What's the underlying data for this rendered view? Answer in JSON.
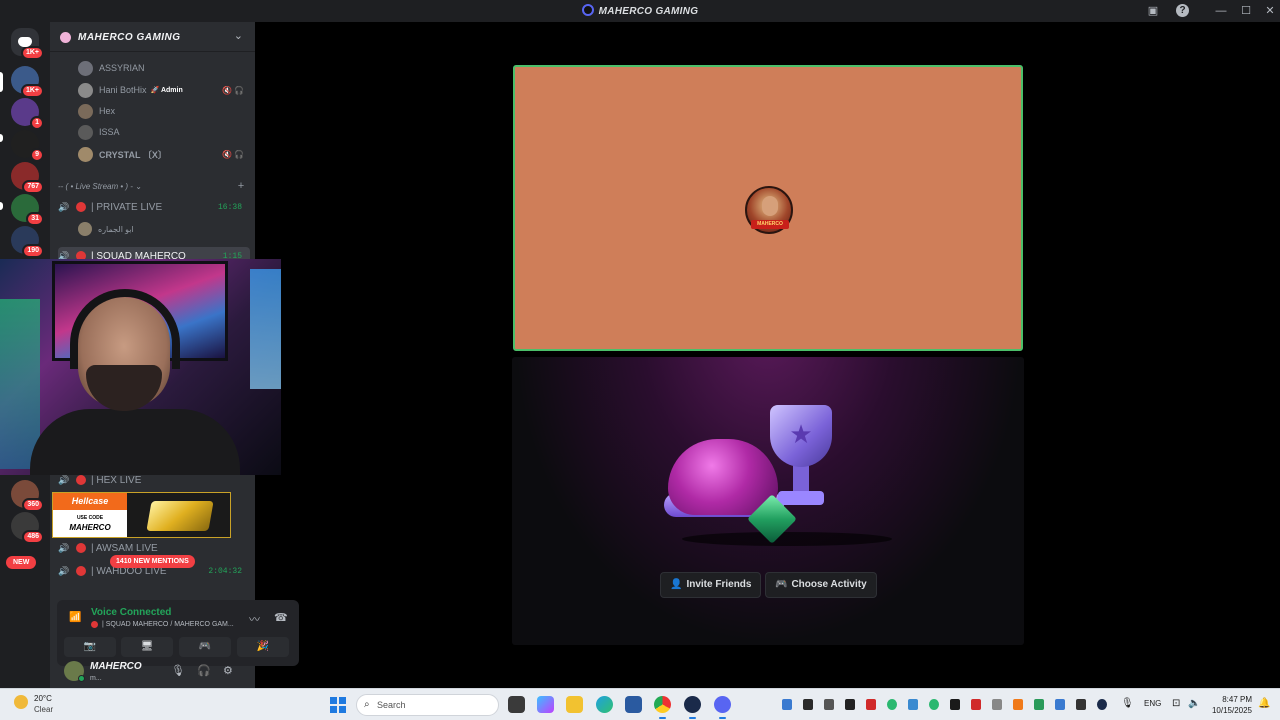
{
  "window": {
    "title": "MAHERCO GAMING",
    "controls": {
      "minimize": "—",
      "maximize": "☐",
      "close": "✕",
      "help": "?"
    }
  },
  "rail": {
    "badges": [
      "1K+",
      "1K+",
      "1",
      "9",
      "767",
      "31",
      "190",
      "360",
      "486"
    ],
    "new_label": "NEW"
  },
  "guild": {
    "name": "MAHERCO GAMING",
    "chevron": "⌄"
  },
  "members": [
    {
      "name": "ASSYRIAN"
    },
    {
      "name": "Hani BotHix",
      "role": "Admin"
    },
    {
      "name": "Hex"
    },
    {
      "name": "ISSA"
    },
    {
      "name": "CRYSTAL 〔X〕"
    }
  ],
  "category": {
    "label": "-- ( • Live Stream • ) -",
    "chevron": "⌄",
    "add": "+"
  },
  "voice_channels": [
    {
      "name": "| PRIVATE LIVE",
      "time": "16:38"
    },
    {
      "name": "| SQUAD MAHERCO",
      "time": "1:15"
    },
    {
      "name": "| HEX LIVE",
      "time": ""
    },
    {
      "name": "| AWSAM LIVE",
      "time": ""
    },
    {
      "name": "| WAHDOO LIVE",
      "time": "2:04:32"
    }
  ],
  "sub_user": {
    "name": "ابو الجماره"
  },
  "ad": {
    "brand": "Hellcase",
    "use_code": "USE CODE",
    "code": "MAHERCO"
  },
  "mentions_label": "1410 NEW MENTIONS",
  "voice_panel": {
    "title": "Voice Connected",
    "subtitle": "| SQUAD MAHERCO / MAHERCO GAM..."
  },
  "user": {
    "name": "MAHERCO",
    "status": "m..."
  },
  "stage": {
    "avatar_tag": "MAHERCO",
    "invite_label": "Invite Friends",
    "activity_label": "Choose Activity"
  },
  "taskbar": {
    "temperature": "20°C",
    "condition": "Clear",
    "search_placeholder": "Search",
    "language": "ENG",
    "time": "8:47 PM",
    "date": "10/15/2025"
  },
  "colors": {
    "accent_green": "#23a55a",
    "tile_orange": "#cf7e59",
    "live_red": "#e03737",
    "blurple": "#5865f2"
  }
}
